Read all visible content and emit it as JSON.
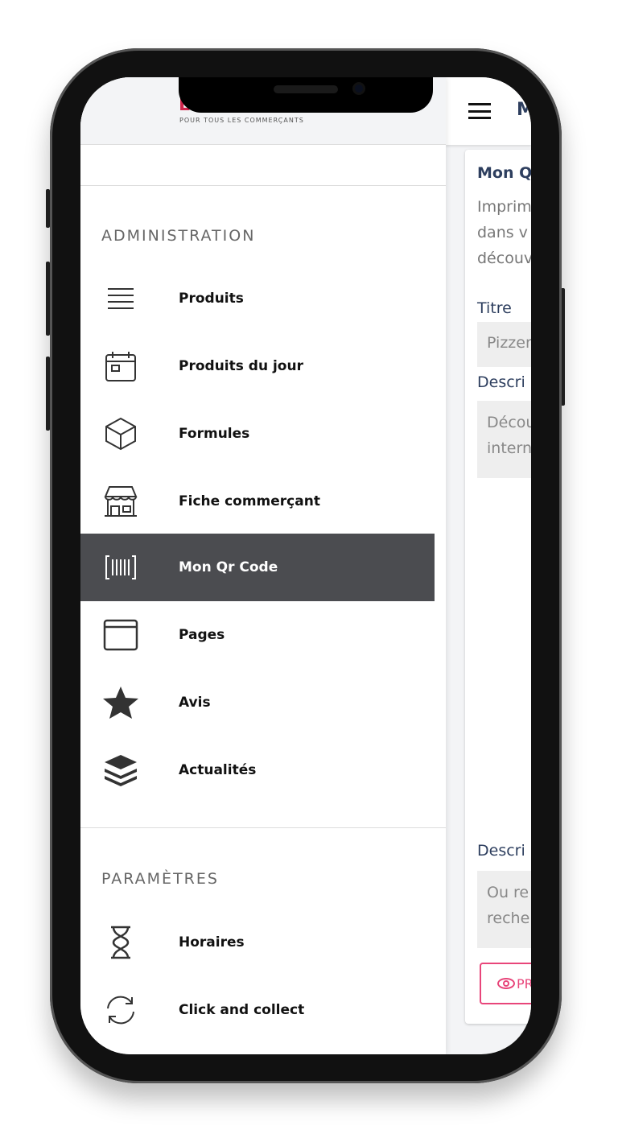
{
  "logo": {
    "letter": "L",
    "tagline": "POUR TOUS LES COMMERÇANTS"
  },
  "topbar": {
    "title": "M"
  },
  "sections": [
    {
      "title": "ADMINISTRATION"
    },
    {
      "title": "PARAMÈTRES"
    }
  ],
  "menu": [
    {
      "label": "Produits",
      "icon": "list-icon"
    },
    {
      "label": "Produits du jour",
      "icon": "calendar-icon"
    },
    {
      "label": "Formules",
      "icon": "cube-icon"
    },
    {
      "label": "Fiche commerçant",
      "icon": "store-icon"
    },
    {
      "label": "Mon Qr Code",
      "icon": "barcode-icon",
      "active": true
    },
    {
      "label": "Pages",
      "icon": "window-icon"
    },
    {
      "label": "Avis",
      "icon": "star-icon"
    },
    {
      "label": "Actualités",
      "icon": "layers-icon"
    }
  ],
  "settings": [
    {
      "label": "Horaires",
      "icon": "hourglass-icon"
    },
    {
      "label": "Click and collect",
      "icon": "refresh-icon"
    }
  ],
  "card": {
    "title": "Mon Q",
    "intro": [
      "Imprim",
      "dans v",
      "découv"
    ],
    "title_label": "Titre",
    "title_value": "Pizzer",
    "desc_label": "Descri",
    "desc_value": [
      "Décou",
      "intern"
    ],
    "desc2_label": "Descri",
    "desc2_value": [
      "Ou re",
      "reche"
    ],
    "preview_button": "PR"
  },
  "colors": {
    "active_bg": "#4b4c50",
    "accent": "#e8457a",
    "heading": "#2d3e5e"
  }
}
